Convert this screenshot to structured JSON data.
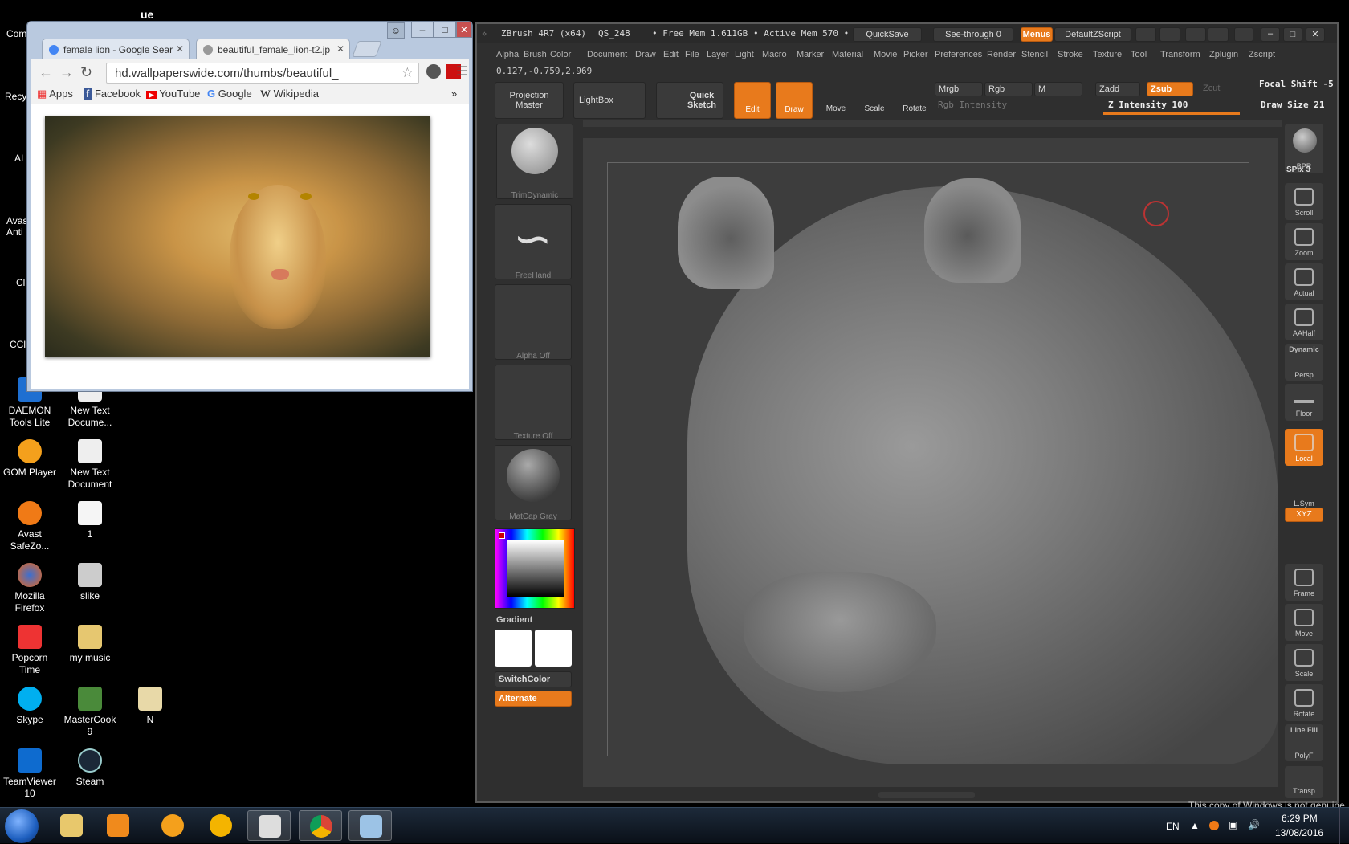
{
  "desktop": {
    "icons": [
      {
        "label": "DAEMON Tools Lite"
      },
      {
        "label": "New Text Docume..."
      },
      {
        "label": "GOM Player"
      },
      {
        "label": "New Text Document"
      },
      {
        "label": "Avast SafeZo..."
      },
      {
        "label": "1"
      },
      {
        "label": "Mozilla Firefox"
      },
      {
        "label": "slike"
      },
      {
        "label": "Popcorn Time"
      },
      {
        "label": "my music"
      },
      {
        "label": "Skype"
      },
      {
        "label": "MasterCook 9"
      },
      {
        "label": "N"
      },
      {
        "label": "TeamViewer 10"
      },
      {
        "label": "Steam"
      }
    ],
    "partial_labels": [
      "Com",
      "Recy",
      "AI",
      "Avas Anti",
      "Cl",
      "CCl"
    ],
    "top_partial": "ue"
  },
  "chrome": {
    "tabs": [
      {
        "title": "female lion - Google Sear"
      },
      {
        "title": "beautiful_female_lion-t2.jp"
      }
    ],
    "url": "hd.wallpaperswide.com/thumbs/beautiful_",
    "bookmarks": [
      "Apps",
      "Facebook",
      "YouTube",
      "Google",
      "Wikipedia"
    ],
    "more": "»"
  },
  "zbrush": {
    "title": "ZBrush 4R7 (x64)",
    "qs": "QS_248",
    "free_mem": "• Free Mem 1.611GB",
    "active_mem": "• Active Mem 570 •",
    "quicksave": "QuickSave",
    "seethrough": "See-through  0",
    "menus_btn": "Menus",
    "script": "DefaultZScript",
    "menu": [
      "Alpha",
      "Brush",
      "Color",
      "Document",
      "Draw",
      "Edit",
      "File",
      "Layer",
      "Light",
      "Macro",
      "Marker",
      "Material",
      "Movie",
      "Picker",
      "Preferences",
      "Render",
      "Stencil",
      "Stroke",
      "Texture",
      "Tool",
      "Transform",
      "Zplugin",
      "Zscript"
    ],
    "coords": "0.127,-0.759,2.969",
    "projection": "Projection Master",
    "lightbox": "LightBox",
    "quicksketch": "Quick Sketch",
    "modes": [
      "Edit",
      "Draw",
      "Move",
      "Scale",
      "Rotate"
    ],
    "mrgb": "Mrgb",
    "rgb": "Rgb",
    "m": "M",
    "zadd": "Zadd",
    "zsub": "Zsub",
    "zcut": "Zcut",
    "rgb_intensity": "Rgb Intensity",
    "z_intensity": "Z Intensity 100",
    "focal_shift": "Focal Shift -5",
    "draw_size": "Draw Size 21",
    "tiles": [
      "TrimDynamic",
      "FreeHand",
      "Alpha Off",
      "Texture Off",
      "MatCap Gray"
    ],
    "gradient": "Gradient",
    "switchcolor": "SwitchColor",
    "alternate": "Alternate",
    "right_shelf": [
      "BPR",
      "SPix 3",
      "Scroll",
      "Zoom",
      "Actual",
      "AAHalf",
      "Persp",
      "Floor",
      "Local",
      "L.Sym",
      "XYZ",
      "Frame",
      "Move",
      "Scale",
      "Rotate",
      "PolyF",
      "Transp"
    ],
    "dynamic": "Dynamic",
    "linefill": "Line Fill"
  },
  "taskbar": {
    "lang": "EN",
    "time": "6:29 PM",
    "date": "13/08/2016",
    "notice": "This copy of Windows is not genuine"
  }
}
